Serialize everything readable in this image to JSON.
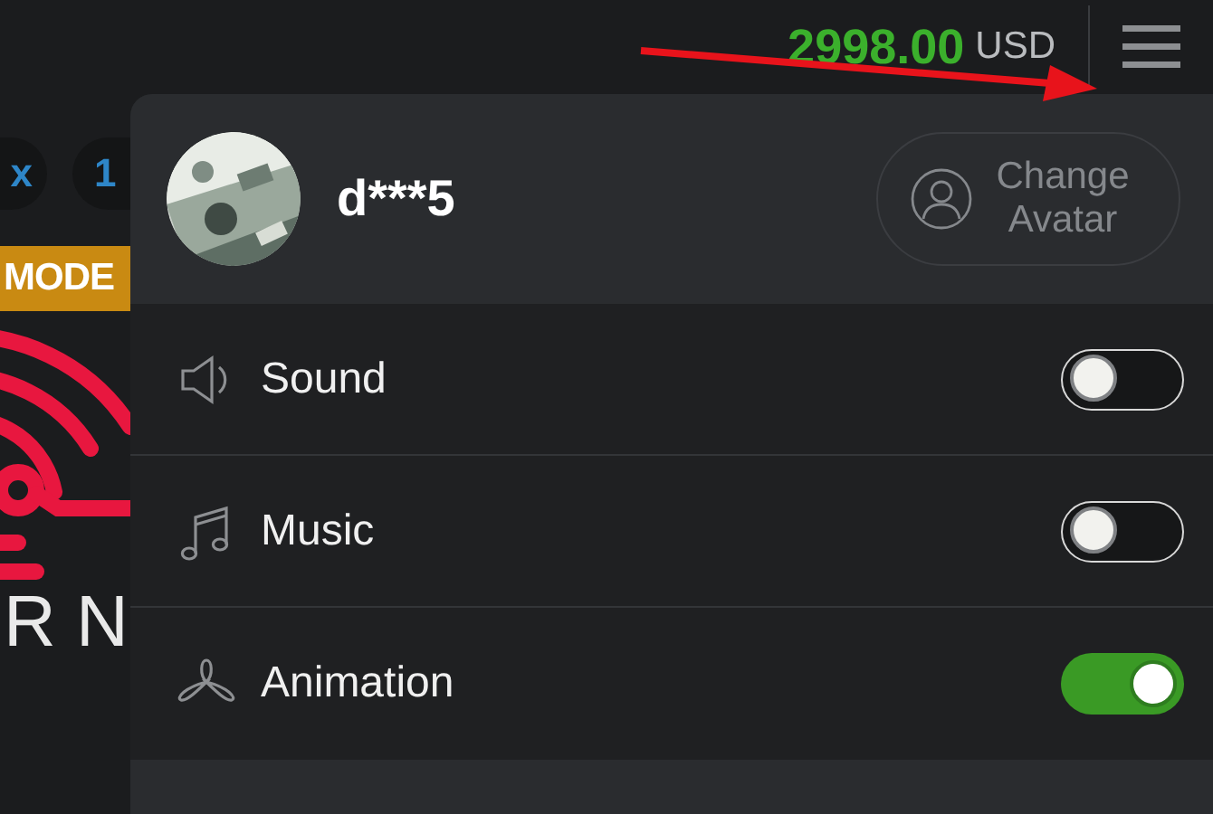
{
  "balance": {
    "amount": "2998.00",
    "currency": "USD"
  },
  "background": {
    "chips": [
      "x",
      "1"
    ],
    "badge": "MODE",
    "title": "R N"
  },
  "profile": {
    "username": "d***5",
    "change_avatar": "Change Avatar"
  },
  "settings": [
    {
      "kind": "sound",
      "label": "Sound",
      "on": false
    },
    {
      "kind": "music",
      "label": "Music",
      "on": false
    },
    {
      "kind": "animation",
      "label": "Animation",
      "on": true
    }
  ]
}
